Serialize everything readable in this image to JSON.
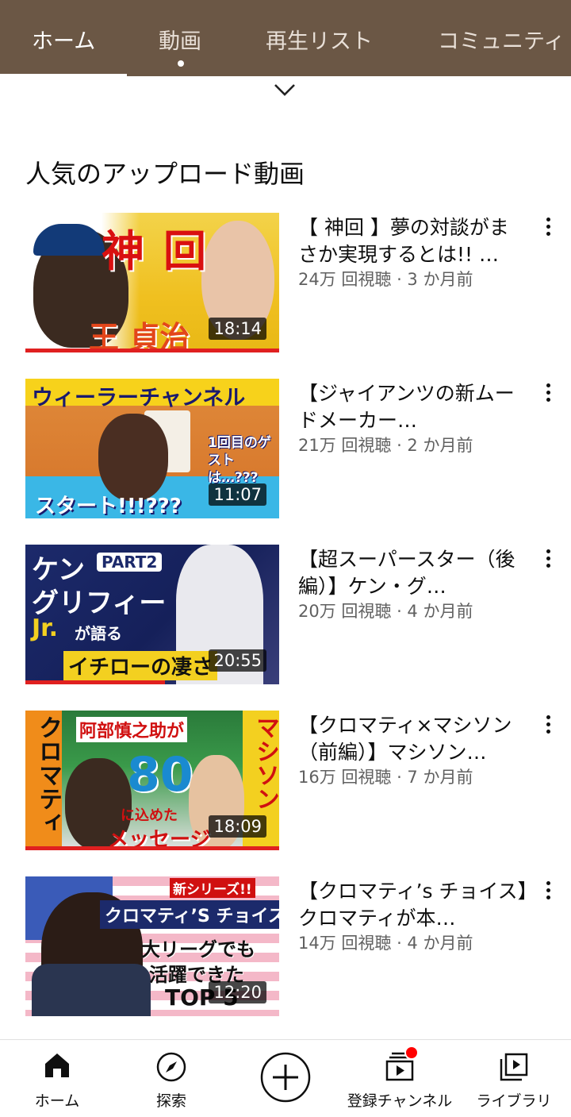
{
  "tabs": [
    {
      "label": "ホーム",
      "active": true
    },
    {
      "label": "動画",
      "active": false
    },
    {
      "label": "再生リスト",
      "active": false
    },
    {
      "label": "コミュニティ",
      "active": false
    }
  ],
  "section": {
    "title": "人気のアップロード動画"
  },
  "videos": [
    {
      "title": "【 神回 】夢の対談がまさか実現するとは!! …",
      "meta": "24万 回視聴 · 3 か月前",
      "duration": "18:14",
      "thumb_text": [
        "神",
        "回",
        "王 貞治"
      ],
      "watched_fraction": 1.0
    },
    {
      "title": "【ジャイアンツの新ムードメーカー…",
      "meta": "21万 回視聴 · 2 か月前",
      "duration": "11:07",
      "thumb_text": [
        "ウィーラーチャンネル",
        "1回目のゲストは…???",
        "スタート!!!???"
      ],
      "watched_fraction": 0
    },
    {
      "title": "【超スーパースター（後編）】ケン・グ…",
      "meta": "20万 回視聴 · 4 か月前",
      "duration": "20:55",
      "thumb_text": [
        "ケン",
        "グリフィー",
        "Jr.",
        "が語る",
        "PART2",
        "イチローの凄さ"
      ],
      "watched_fraction": 0.55
    },
    {
      "title": "【クロマティ×マシソン（前編）】マシソン…",
      "meta": "16万 回視聴 · 7 か月前",
      "duration": "18:09",
      "thumb_text": [
        "阿部慎之助が",
        "80",
        "に込めた",
        "メッセージ",
        "クロマティ",
        "マシソン"
      ],
      "watched_fraction": 1.0
    },
    {
      "title": "【クロマティ’s チョイス】クロマティが本…",
      "meta": "14万 回視聴 · 4 か月前",
      "duration": "12:20",
      "thumb_text": [
        "新シリーズ!!",
        "クロマティ’S チョイス",
        "大リーグでも",
        "活躍できた",
        "TOP 5"
      ],
      "watched_fraction": 0
    }
  ],
  "bottom_nav": [
    {
      "label": "ホーム",
      "icon": "home-icon"
    },
    {
      "label": "探索",
      "icon": "compass-icon"
    },
    {
      "label": "",
      "icon": "create-plus-icon"
    },
    {
      "label": "登録チャンネル",
      "icon": "subscriptions-icon",
      "has_badge": true
    },
    {
      "label": "ライブラリ",
      "icon": "library-icon"
    }
  ],
  "colors": {
    "header": "#6b5745",
    "progress": "#e02020",
    "badge": "#ff0000"
  }
}
